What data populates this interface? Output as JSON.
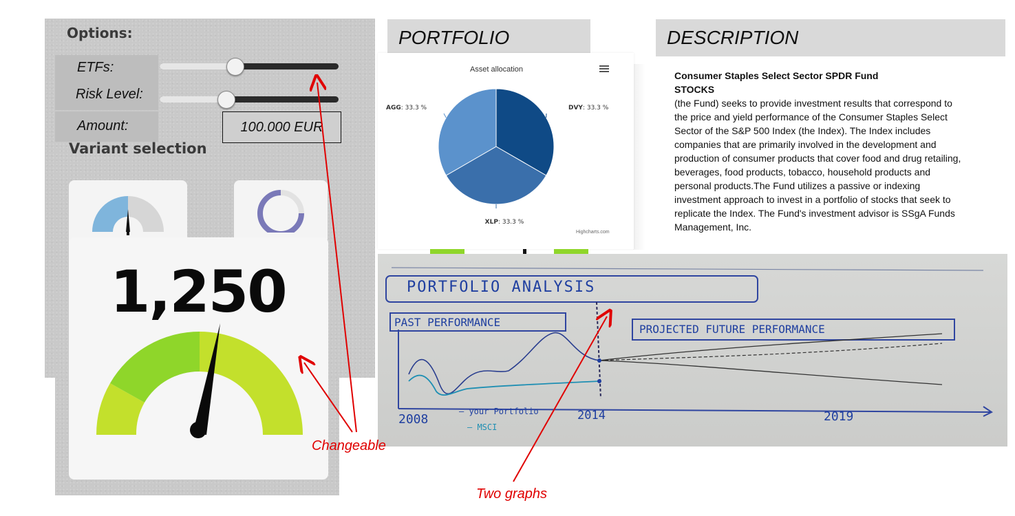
{
  "options": {
    "title": "Options:",
    "etfs_label": "ETFs:",
    "etfs_value": 0.42,
    "risk_label": "Risk Level:",
    "risk_value": 0.37,
    "amount_label": "Amount:",
    "amount_value": "100.000 EUR",
    "variant_title": "Variant selection",
    "gauge_value": "1,250"
  },
  "portfolio": {
    "header": "PORTFOLIO",
    "chart_title": "Asset allocation",
    "credit": "Highcharts.com"
  },
  "chart_data": {
    "type": "pie",
    "title": "Asset allocation",
    "labels": [
      "DVY",
      "XLP",
      "AGG"
    ],
    "values": [
      33.3,
      33.3,
      33.3
    ],
    "value_suffix": " %",
    "colors": [
      "#0f4a86",
      "#3a6fab",
      "#5b92cc"
    ]
  },
  "description": {
    "header": "DESCRIPTION",
    "fund_name": "Consumer Staples Select Sector SPDR Fund",
    "category": "STOCKS",
    "text": "(the Fund) seeks to provide investment results that correspond to the price and yield performance of the Consumer Staples Select Sector of the S&P 500 Index (the Index). The Index includes companies that are primarily involved in the development and production of consumer products that cover food and drug retailing, beverages, food products, tobacco, household products and personal products.The Fund utilizes a passive or indexing investment approach to invest in a portfolio of stocks that seek to replicate the Index. The Fund's investment advisor is SSgA Funds Management, Inc."
  },
  "sketch": {
    "title": "PORTFOLIO ANALYSIS",
    "past_label": "PAST PERFORMANCE",
    "future_label": "PROJECTED FUTURE PERFORMANCE",
    "year_start": "2008",
    "year_mid": "2014",
    "year_end": "2019",
    "legend_portfolio": "— your Portfolio",
    "legend_msci": "— MSCI"
  },
  "annotations": {
    "changeable": "Changeable",
    "two_graphs": "Two graphs"
  },
  "colors": {
    "annotation_red": "#e00000",
    "gauge_green": "#8fd62a",
    "gauge_lime": "#c3e02c",
    "sketch_ink": "#1f3fa0"
  }
}
